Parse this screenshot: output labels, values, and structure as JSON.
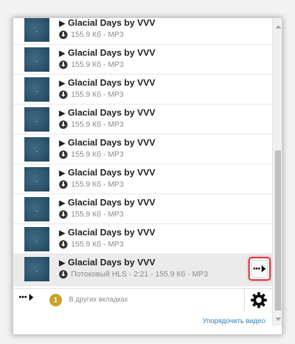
{
  "tracks": [
    {
      "title": "Glacial Days by VVV",
      "meta": "155.9 Кб - MP3"
    },
    {
      "title": "Glacial Days by VVV",
      "meta": "155.9 Кб - MP3"
    },
    {
      "title": "Glacial Days by VVV",
      "meta": "155.9 Кб - MP3"
    },
    {
      "title": "Glacial Days by VVV",
      "meta": "155.9 Кб - MP3"
    },
    {
      "title": "Glacial Days by VVV",
      "meta": "155.9 Кб - MP3"
    },
    {
      "title": "Glacial Days by VVV",
      "meta": "155.9 Кб - MP3"
    },
    {
      "title": "Glacial Days by VVV",
      "meta": "155.9 Кб - MP3"
    },
    {
      "title": "Glacial Days by VVV",
      "meta": "155.9 Кб - MP3"
    },
    {
      "title": "Glacial Days by VVV",
      "meta": "Потоковый HLS - 2:21 - 155.9 Кб - MP3"
    }
  ],
  "row_more_label": "•••",
  "bottom_bar": {
    "more_label": "•••",
    "badge_count": "1",
    "other_tabs_label": "В других вкладках"
  },
  "sort_link_label": "Упорядочить видео",
  "colors": {
    "highlight_border": "#e02f36",
    "badge": "#c9a227",
    "link": "#3a79b5"
  }
}
